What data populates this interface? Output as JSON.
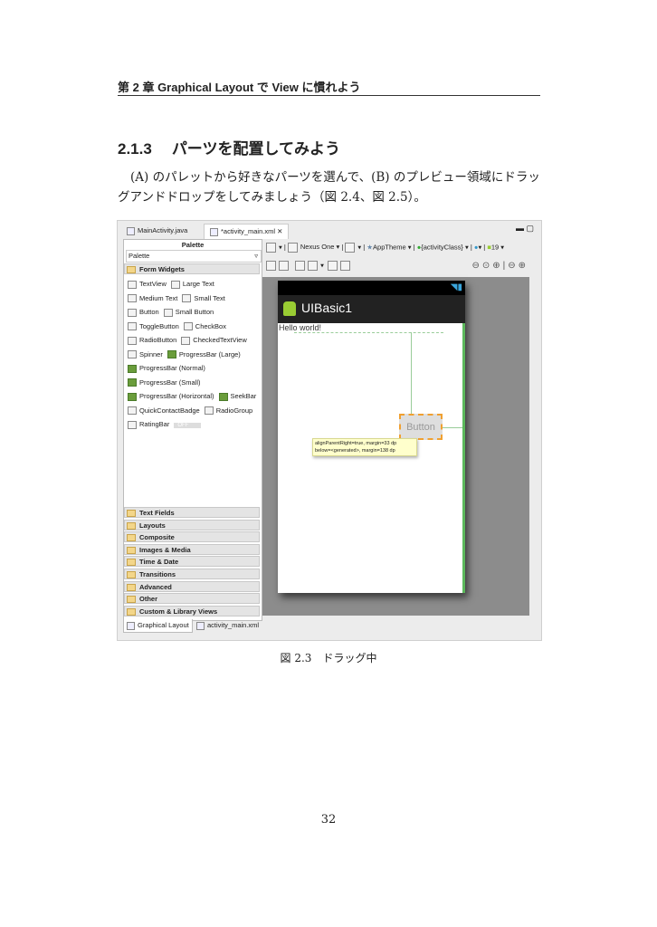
{
  "running_header": "第 2 章 Graphical Layout で View に慣れよう",
  "section": {
    "number": "2.1.3",
    "title": "パーツを配置してみよう"
  },
  "paragraph": "(A) のパレットから好きなパーツを選んで、(B) のプレビュー領域にドラッグアンドドロップをしてみましょう（図 2.4、図 2.5）。",
  "figure": {
    "editor_tabs": [
      "MainActivity.java",
      "*activity_main.xml"
    ],
    "palette": {
      "title": "Palette",
      "dropdown": "Palette",
      "open_category": "Form Widgets",
      "widgets": [
        [
          "TextView",
          "Large Text"
        ],
        [
          "Medium Text",
          "Small Text"
        ],
        [
          "Button",
          "Small Button"
        ],
        [
          "ToggleButton",
          "CheckBox"
        ],
        [
          "RadioButton",
          "CheckedTextView"
        ],
        [
          "Spinner",
          "ProgressBar (Large)"
        ],
        [
          "ProgressBar (Normal)"
        ],
        [
          "ProgressBar (Small)"
        ],
        [
          "ProgressBar (Horizontal)",
          "SeekBar"
        ],
        [
          "QuickContactBadge",
          "RadioGroup"
        ],
        [
          "RatingBar",
          "OFF"
        ]
      ],
      "categories": [
        "Text Fields",
        "Layouts",
        "Composite",
        "Images & Media",
        "Time & Date",
        "Transitions",
        "Advanced",
        "Other",
        "Custom & Library Views"
      ]
    },
    "bottom_tabs": [
      "Graphical Layout",
      "activity_main.xml"
    ],
    "toolbar": {
      "device": "Nexus One",
      "theme": "AppTheme",
      "activity": "{activityClass}",
      "api": "19"
    },
    "preview": {
      "app_title": "UIBasic1",
      "hello": "Hello world!",
      "button": "Button",
      "tooltip": [
        "alignParentRight=true, margin=33 dp",
        "below=<generated>, margin=138 dp"
      ]
    },
    "caption": "図 2.3　ドラッグ中"
  },
  "page_number": "32"
}
